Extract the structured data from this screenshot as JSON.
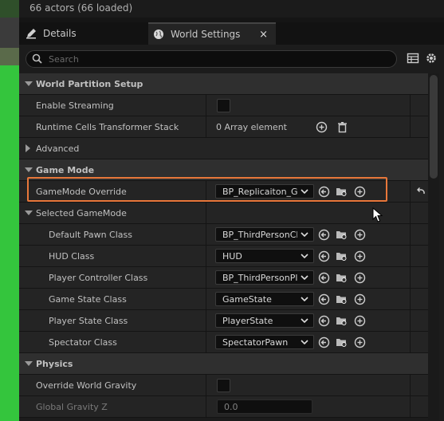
{
  "outliner": {
    "actor_count": "66 actors (66 loaded)"
  },
  "tabs": [
    {
      "label": "Details",
      "icon": "pencil-icon"
    },
    {
      "label": "World Settings",
      "icon": "globe-icon",
      "close": "×"
    }
  ],
  "search": {
    "placeholder": "Search"
  },
  "sections": {
    "world_partition": "World Partition Setup",
    "enable_streaming": "Enable Streaming",
    "runtime_cells": "Runtime Cells Transformer Stack",
    "runtime_cells_value": "0 Array element",
    "advanced": "Advanced",
    "game_mode": "Game Mode",
    "gamemode_override": "GameMode Override",
    "gamemode_override_value": "BP_Replicaiton_Ga",
    "selected_gamemode": "Selected GameMode",
    "default_pawn": "Default Pawn Class",
    "default_pawn_value": "BP_ThirdPersonCl",
    "hud": "HUD Class",
    "hud_value": "HUD",
    "player_controller": "Player Controller Class",
    "player_controller_value": "BP_ThirdPersonPl",
    "game_state": "Game State Class",
    "game_state_value": "GameState",
    "player_state": "Player State Class",
    "player_state_value": "PlayerState",
    "spectator": "Spectator Class",
    "spectator_value": "SpectatorPawn",
    "physics": "Physics",
    "override_gravity": "Override World Gravity",
    "global_gravity": "Global Gravity Z",
    "global_gravity_value": "0.0"
  },
  "colors": {
    "highlight": "#e8773a",
    "viewport_green": "#34c53d"
  }
}
